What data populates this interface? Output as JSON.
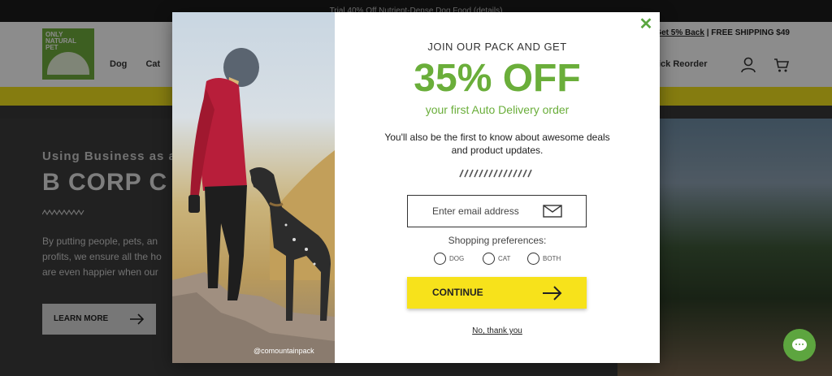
{
  "topbar": {
    "text": "Trial 40% Off Nutrient-Dense Dog Food (details)"
  },
  "header": {
    "util_link": "Get 5% Back",
    "util_shipping": "| FREE SHIPPING $49",
    "logo_text": "ONLY NATURAL PET",
    "nav_items": [
      "Dog",
      "Cat"
    ],
    "quick_reorder": "ick Reorder",
    "icons": [
      "account-icon",
      "cart-icon"
    ]
  },
  "hero": {
    "eyebrow": "Using Business as a",
    "title": "B CORP C",
    "body": "By putting people, pets, an profits, we ensure all the ho are even happier when our",
    "button": "LEARN MORE"
  },
  "modal": {
    "eyebrow": "JOIN OUR PACK AND GET",
    "headline": "35% OFF",
    "subheadline": "your first Auto Delivery order",
    "description": "You'll also be the first to know about awesome deals and product updates.",
    "email_placeholder": "Enter email address",
    "prefs_label": "Shopping preferences:",
    "prefs": [
      "DOG",
      "CAT",
      "BOTH"
    ],
    "continue_label": "CONTINUE",
    "no_thanks": "No, thank you",
    "photo_credit": "@comountainpack",
    "close_symbol": "✕"
  },
  "colors": {
    "accent_green": "#6aae3a",
    "button_yellow": "#f7e21b",
    "chat_green": "#5da53f"
  }
}
